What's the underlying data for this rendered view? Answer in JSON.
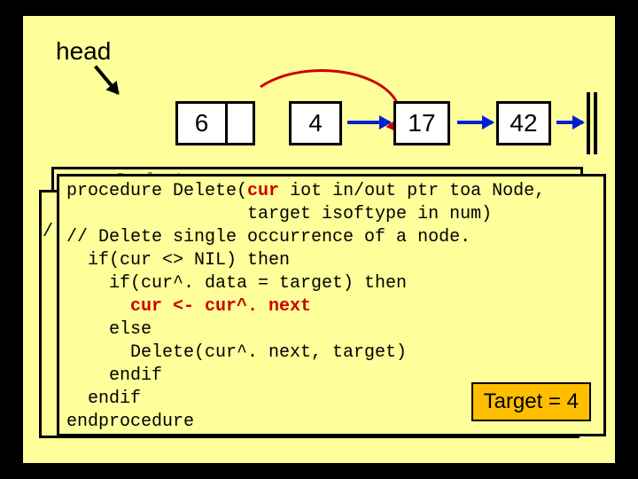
{
  "head_label": "head",
  "nodes": {
    "n0": "6",
    "n1": "4",
    "n2": "17",
    "n3": "42"
  },
  "target_badge": "Target = 4",
  "peek_top": "p    r    D  l   t",
  "peek_left": "/",
  "code": {
    "l1a": "procedure Delete(",
    "l1b": "cur",
    "l1c": " iot in/out ptr toa Node,",
    "l2": "                 target isoftype in num)",
    "l3": "// Delete single occurrence of a node.",
    "l4": "  if(cur <> NIL) then",
    "l5": "    if(cur^. data = target) then",
    "l6": "      cur <- cur^. next",
    "l7": "    else",
    "l8": "      Delete(cur^. next, target)",
    "l9": "    endif",
    "l10": "  endif",
    "l11": "endprocedure"
  },
  "chart_data": {
    "type": "linked-list-diagram",
    "head": "head",
    "list": [
      6,
      4,
      17,
      42
    ],
    "delete_target": 4,
    "bypass_edge": {
      "from": 6,
      "to": 17,
      "color": "red",
      "meaning": "cur <- cur^.next skips node 4"
    },
    "next_edges": [
      {
        "from": 4,
        "to": 17,
        "color": "blue"
      },
      {
        "from": 17,
        "to": 42,
        "color": "blue"
      },
      {
        "from": 42,
        "to": "NIL",
        "color": "blue"
      }
    ],
    "pseudocode": [
      "procedure Delete(cur iot in/out ptr toa Node,",
      "                 target isoftype in num)",
      "// Delete single occurrence of a node.",
      "  if(cur <> NIL) then",
      "    if(cur^.data = target) then",
      "      cur <- cur^.next",
      "    else",
      "      Delete(cur^.next, target)",
      "    endif",
      "  endif",
      "endprocedure"
    ]
  }
}
